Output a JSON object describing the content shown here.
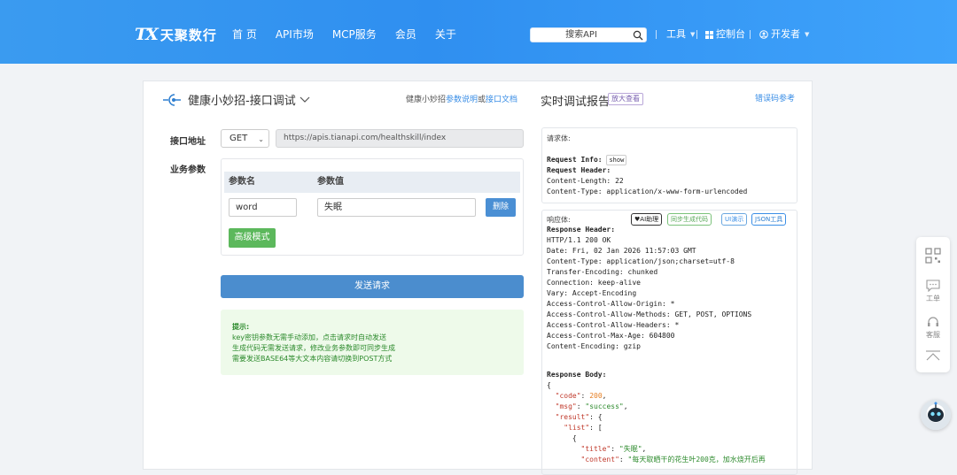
{
  "header": {
    "logo_mark": "TX",
    "logo_name": "天聚数行",
    "nav": [
      "首 页",
      "API市场",
      "MCP服务",
      "会员",
      "关于"
    ],
    "search_placeholder": "搜索API",
    "tools_label": "工具",
    "console_label": "控制台",
    "developer_label": "开发者",
    "colors": {
      "bar": "#3a9bf0"
    }
  },
  "api": {
    "title": "健康小妙招-接口调试",
    "doc_prefix": "健康小妙招",
    "doc_link1": "参数说明",
    "doc_mid": "或",
    "doc_link2": "接口文档",
    "address_label": "接口地址",
    "method": "GET",
    "url": "https://apis.tianapi.com/healthskill/index",
    "params_label": "业务参数",
    "col_name": "参数名",
    "col_value": "参数值",
    "param_name": "word",
    "param_value": "失眠",
    "delete_label": "删除",
    "advanced_label": "高级模式",
    "send_label": "发送请求",
    "tips": {
      "title": "提示:",
      "line1": "key密钥参数无需手动添加，点击请求时自动发送",
      "line2": "生成代码无需发送请求，修改业务参数即可同步生成",
      "line3": "需要发送BASE64等大文本内容请切换到POST方式"
    }
  },
  "report": {
    "title": "实时调试报告",
    "zoom_badge": "放大查看",
    "error_link": "错误码参考",
    "request_label": "请求体:",
    "req_info_key": "Request Info:",
    "req_info_tag": "show",
    "req_header_key": "Request Header:",
    "req_headers": [
      "Content-Length: 22",
      "Content-Type: application/x-www-form-urlencoded"
    ],
    "response_label": "响应体:",
    "chips": [
      "AI助理",
      "同步生成代码",
      "UI演示",
      "JSON工具"
    ],
    "resp_header_key": "Response Header:",
    "resp_headers": [
      "HTTP/1.1 200 OK",
      "Date: Fri, 02 Jan 2026 11:57:03 GMT",
      "Content-Type: application/json;charset=utf-8",
      "Transfer-Encoding: chunked",
      "Connection: keep-alive",
      "Vary: Accept-Encoding",
      "Access-Control-Allow-Origin: *",
      "Access-Control-Allow-Methods: GET, POST, OPTIONS",
      "Access-Control-Allow-Headers: *",
      "Access-Control-Max-Age: 604800",
      "Content-Encoding: gzip"
    ],
    "resp_body_key": "Response Body:",
    "json_open": "{",
    "json_code_key": "\"code\"",
    "json_code_val": "200",
    "json_msg_key": "\"msg\"",
    "json_msg_val": "\"success\"",
    "json_result_key": "\"result\"",
    "json_list_key": "\"list\"",
    "json_title_key": "\"title\"",
    "json_title_val": "\"失眠\"",
    "json_content_key": "\"content\"",
    "json_content_val": "\"每天取晒干的花生叶200克，加水烧开后再"
  },
  "side": {
    "ticket_label": "工单",
    "service_label": "客服"
  }
}
